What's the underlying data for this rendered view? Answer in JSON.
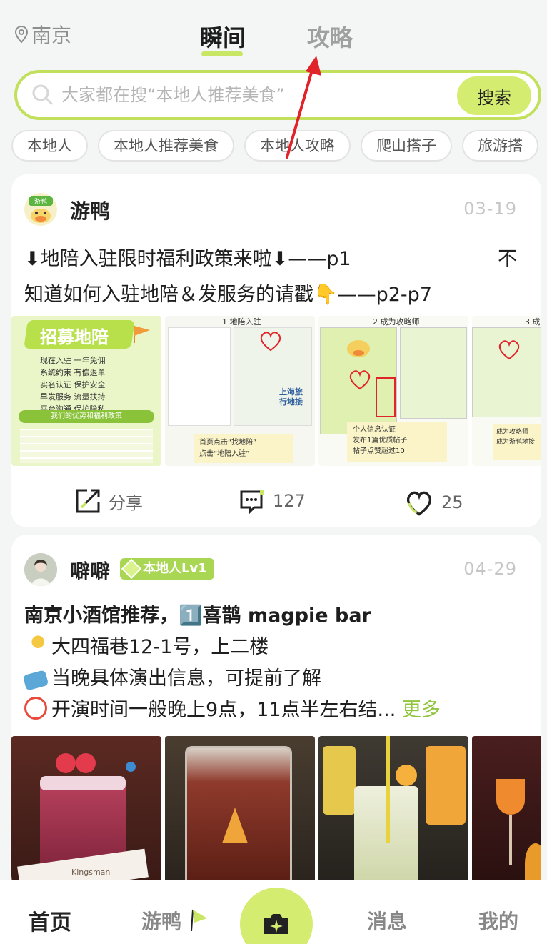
{
  "header": {
    "location": "南京",
    "tabs": [
      {
        "label": "瞬间",
        "active": true
      },
      {
        "label": "攻略",
        "active": false
      }
    ]
  },
  "search": {
    "placeholder": "大家都在搜“本地人推荐美食”",
    "button_label": "搜索"
  },
  "chips": [
    "本地人",
    "本地人推荐美食",
    "本地人攻略",
    "爬山搭子",
    "旅游搭"
  ],
  "posts": [
    {
      "author": "游鸭",
      "avatar_text": "游鸭",
      "date": "03-19",
      "title_line1": "⬇地陪入驻限时福利政策来啦⬇——p1",
      "title_line1_right": "不",
      "title_line2": "知道如何入驻地陪＆发服务的请戳👇——p2-p7",
      "images": [
        {
          "heading": "招募地陪",
          "lines": [
            "现在入驻 一年免佣",
            "系统约束 有偿退单",
            "实名认证 保护安全",
            "早发服务 流量扶持",
            "平台沟通 保护隐私"
          ],
          "footer": "我们的优势和福利政策"
        },
        {
          "step": "1 地陪入驻",
          "notes": [
            "首页点击“找地陪”",
            "点击“地陪入驻”"
          ],
          "label": "上海旅行地接"
        },
        {
          "step": "2 成为攻略师",
          "notes": [
            "个人信息认证",
            "发布1篇优质帖子",
            "帖子点赞超过10"
          ]
        },
        {
          "step": "3 成",
          "notes": [
            "成为攻略师",
            "成为游鸭地接"
          ]
        }
      ],
      "share_label": "分享",
      "comments": "127",
      "likes": "25"
    },
    {
      "author": "噼噼",
      "badge": "本地人Lv1",
      "date": "04-29",
      "lines": [
        "南京小酒馆推荐，1️⃣喜鹊 magpie bar",
        "大四福巷12-1号，上二楼",
        "当晚具体演出信息，可提前了解",
        "开演时间一般晚上9点，11点半左右结..."
      ],
      "more_label": "更多",
      "image_caption": "Kingsman"
    }
  ],
  "bottom_nav": {
    "home": "首页",
    "youya": "游鸭",
    "messages": "消息",
    "mine": "我的"
  },
  "colors": {
    "accent": "#c9e665",
    "accent_dark": "#8fc43c",
    "annotation_arrow": "#e0242a"
  }
}
